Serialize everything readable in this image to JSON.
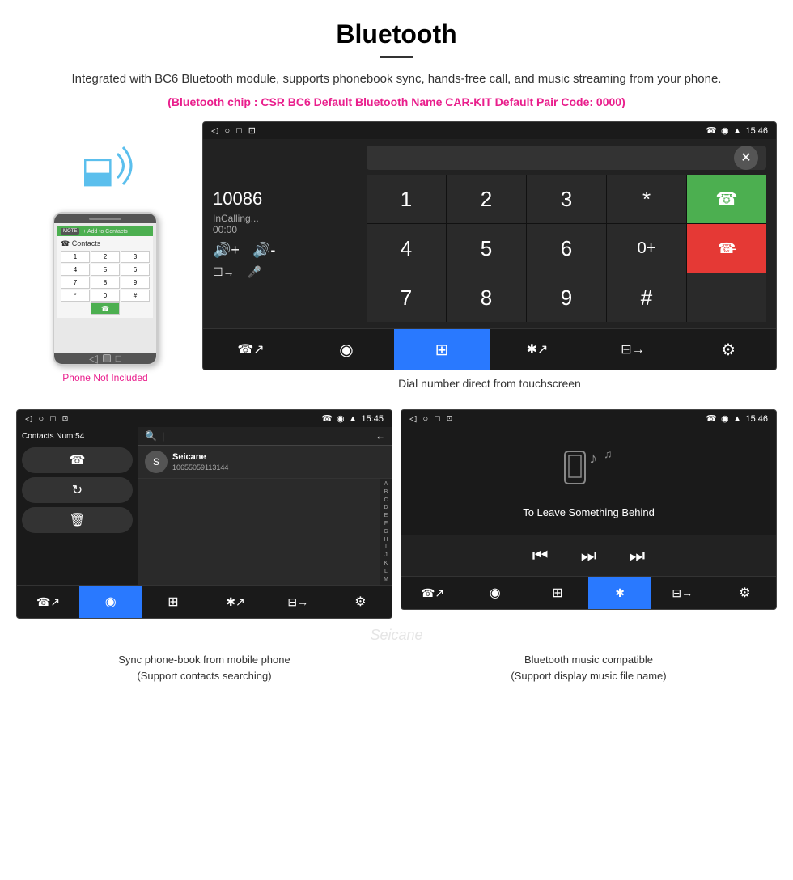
{
  "header": {
    "title": "Bluetooth",
    "description": "Integrated with BC6 Bluetooth module, supports phonebook sync, hands-free call, and music streaming from your phone.",
    "specs": "(Bluetooth chip : CSR BC6    Default Bluetooth Name CAR-KIT    Default Pair Code: 0000)"
  },
  "phone_section": {
    "not_included_label": "Phone Not Included"
  },
  "dial_screen": {
    "status_bar": {
      "left_icons": [
        "◁",
        "○",
        "□",
        "⊡"
      ],
      "right_icons": [
        "☎",
        "◉",
        "▲"
      ],
      "time": "15:46"
    },
    "number": "10086",
    "status": "InCalling...",
    "timer": "00:00",
    "keys": [
      "1",
      "2",
      "3",
      "*",
      "4",
      "5",
      "6",
      "0+",
      "7",
      "8",
      "9",
      "#"
    ],
    "caption": "Dial number direct from touchscreen"
  },
  "contacts_screen": {
    "status_bar": {
      "time": "15:45"
    },
    "contacts_num": "Contacts Num:54",
    "contact_name": "Seicane",
    "contact_number": "10655059113144",
    "alpha": [
      "A",
      "B",
      "C",
      "D",
      "E",
      "F",
      "G",
      "H",
      "I",
      "J",
      "K",
      "L",
      "M"
    ]
  },
  "music_screen": {
    "status_bar": {
      "time": "15:46"
    },
    "song_title": "To Leave Something Behind"
  },
  "bottom_captions": {
    "left": "Sync phone-book from mobile phone\n(Support contacts searching)",
    "right": "Bluetooth music compatible\n(Support display music file name)"
  },
  "nav_items": {
    "call": "☎",
    "contacts": "◉",
    "keypad": "⊞",
    "bluetooth": "✱",
    "phone_transfer": "⊡",
    "settings": "⚙"
  }
}
